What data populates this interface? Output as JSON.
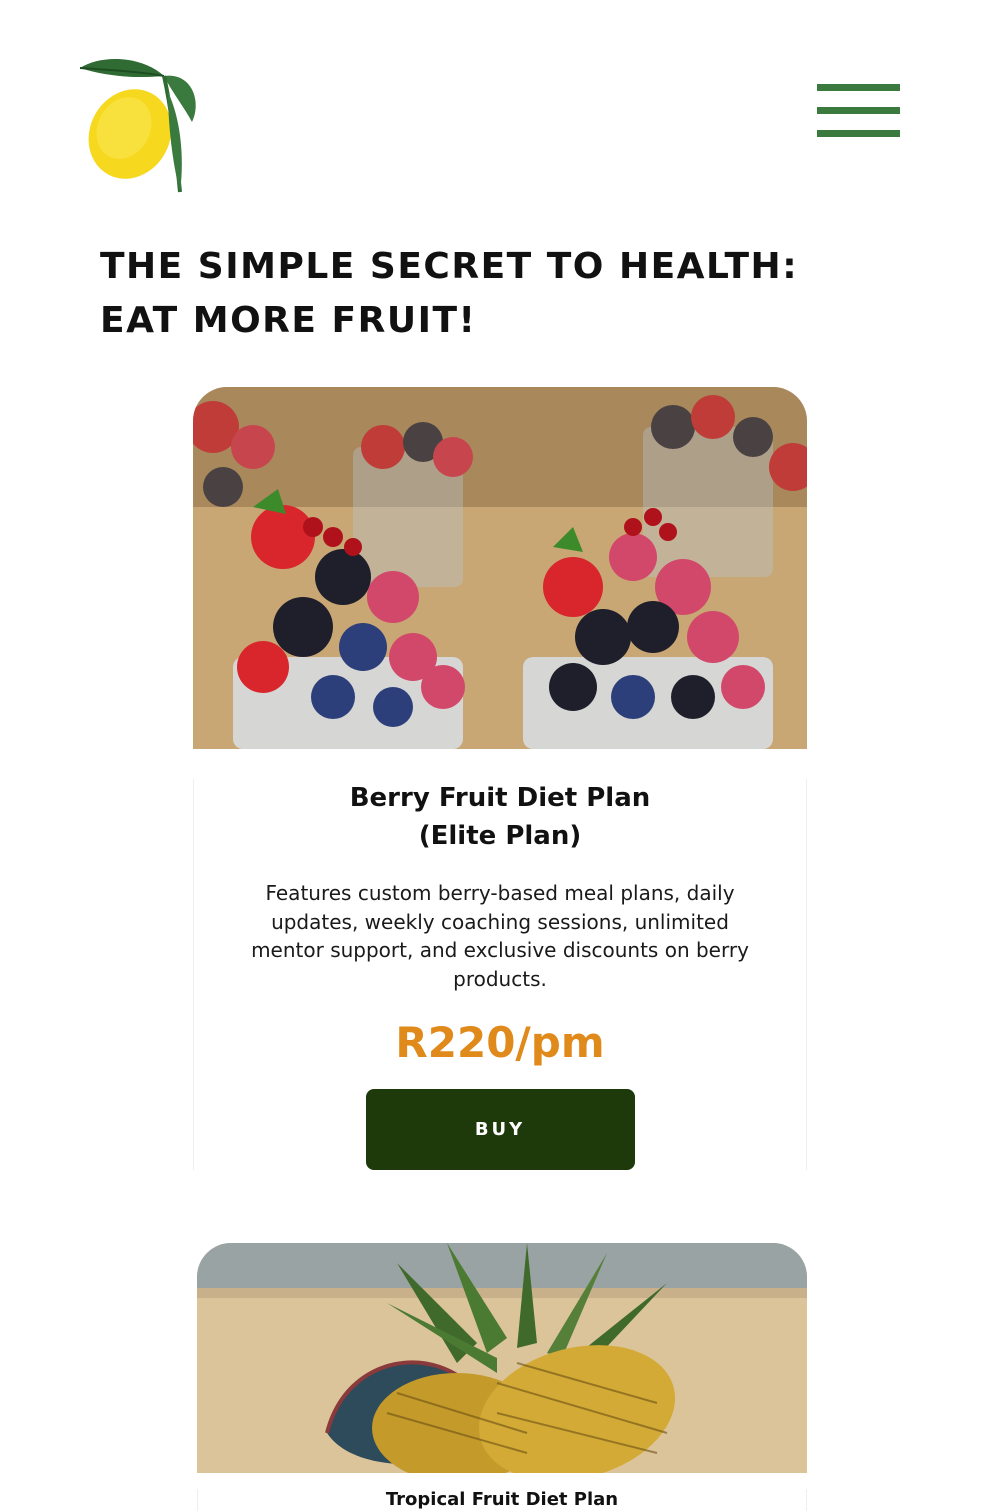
{
  "brand": {
    "logo_icon": "lemon-icon",
    "colors": {
      "menu": "#3b7a3e",
      "price": "#df8a1a",
      "button": "#1e3a0a"
    }
  },
  "header": {
    "menu_icon": "hamburger-menu-icon"
  },
  "headline": "THE SIMPLE SECRET TO HEALTH: EAT MORE FRUIT!",
  "plans": [
    {
      "image": "mixed-berries-photo",
      "title_line1": "Berry Fruit Diet Plan",
      "title_line2": "(Elite Plan)",
      "description": "Features custom berry-based meal plans, daily updates, weekly coaching sessions, unlimited mentor support, and exclusive discounts on berry products.",
      "price": "R220/pm",
      "button_label": "BUY"
    },
    {
      "image": "pineapples-on-beach-photo",
      "title_line1": "Tropical Fruit Diet Plan"
    }
  ]
}
